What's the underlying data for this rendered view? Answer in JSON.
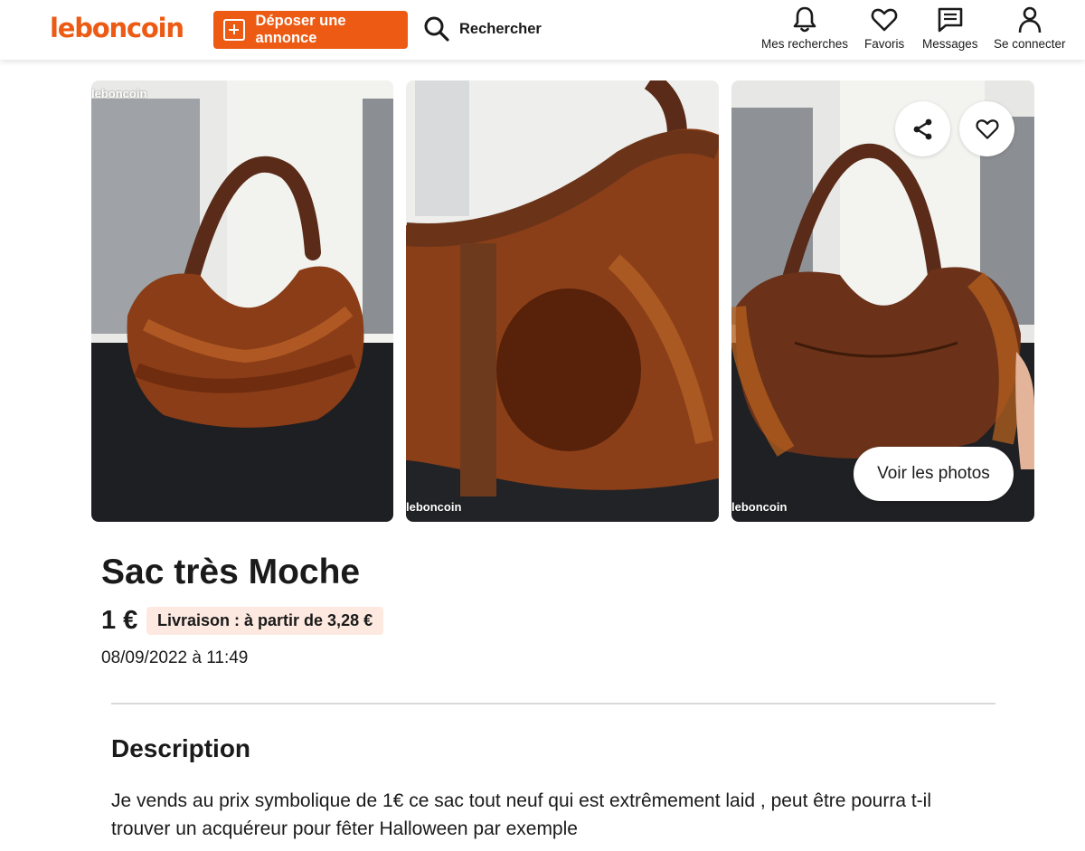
{
  "header": {
    "logo": "leboncoin",
    "post_ad_label": "Déposer une annonce",
    "search_label": "Rechercher",
    "nav": {
      "saved_searches": "Mes recherches",
      "favorites": "Favoris",
      "messages": "Messages",
      "login": "Se connecter"
    }
  },
  "gallery": {
    "watermark": "leboncoin",
    "see_photos_label": "Voir les photos"
  },
  "ad": {
    "title": "Sac très Moche",
    "price": "1 €",
    "delivery": "Livraison : à partir de 3,28 €",
    "date": "08/09/2022 à 11:49"
  },
  "description": {
    "heading": "Description",
    "text": "Je vends au prix symbolique de 1€ ce sac tout neuf qui est extrêmement laid , peut être pourra t-il trouver un acquéreur pour fêter Halloween par exemple"
  },
  "colors": {
    "brand": "#ec5a13",
    "delivery_badge_bg": "#fde9e0"
  }
}
